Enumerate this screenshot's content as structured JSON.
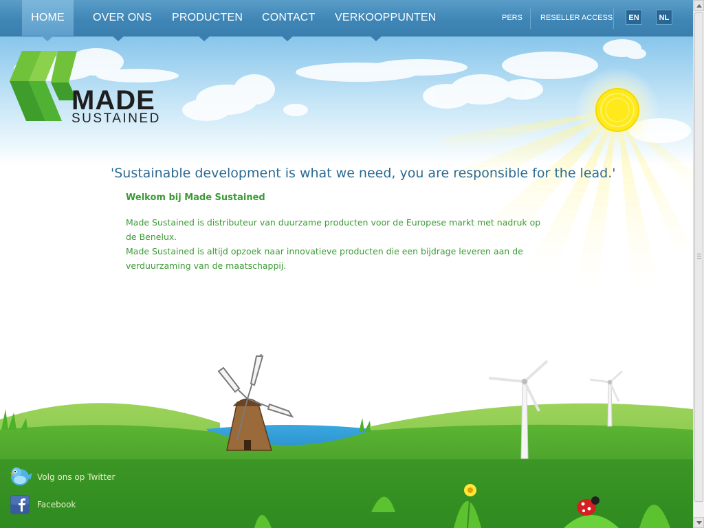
{
  "nav": {
    "items": [
      {
        "label": "HOME"
      },
      {
        "label": "OVER ONS"
      },
      {
        "label": "PRODUCTEN"
      },
      {
        "label": "CONTACT"
      },
      {
        "label": "VERKOOPPUNTEN"
      }
    ],
    "active_index": 0
  },
  "utility": {
    "pers": "PERS",
    "reseller": "RESELLER ACCESS",
    "lang_en": "EN",
    "lang_nl": "NL"
  },
  "logo": {
    "line1": "MADE",
    "line2": "SUSTAINED"
  },
  "content": {
    "quote": "'Sustainable development is what we need, you are responsible for the lead.'",
    "welcome": "Welkom bij Made Sustained",
    "paragraph1": "Made Sustained is distributeur van duurzame producten voor de Europese markt met nadruk op de Benelux.",
    "paragraph2": "Made Sustained is altijd opzoek naar innovatieve producten die een bijdrage leveren aan de verduurzaming van de maatschappij."
  },
  "footer": {
    "twitter": "Volg ons op Twitter",
    "facebook": "Facebook"
  },
  "icons": {
    "twitter": "twitter-bird-icon",
    "facebook": "facebook-icon"
  },
  "colors": {
    "nav_bg": "#3f86b6",
    "quote_text": "#2a6a93",
    "body_text": "#3b9a35",
    "grass": "#3f9a2a",
    "logo_green": "#5cb833"
  }
}
